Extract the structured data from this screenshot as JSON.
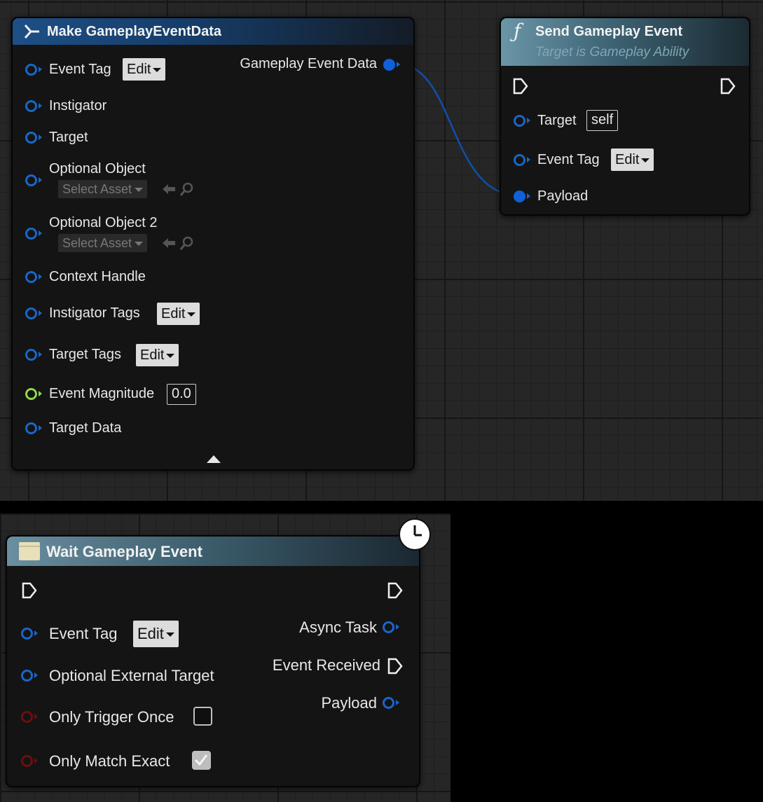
{
  "make_node": {
    "title": "Make GameplayEventData",
    "output_label": "Gameplay Event Data",
    "edit_label": "Edit",
    "select_asset_label": "Select Asset",
    "inputs": {
      "event_tag": "Event Tag",
      "instigator": "Instigator",
      "target": "Target",
      "optional_object": "Optional Object",
      "optional_object_2": "Optional Object 2",
      "context_handle": "Context Handle",
      "instigator_tags": "Instigator Tags",
      "target_tags": "Target Tags",
      "event_magnitude": "Event Magnitude",
      "target_data": "Target Data"
    },
    "event_magnitude_value": "0.0"
  },
  "send_node": {
    "title": "Send Gameplay Event",
    "subtitle": "Target is Gameplay Ability",
    "icon": "function-icon",
    "target_label": "Target",
    "target_value": "self",
    "event_tag_label": "Event Tag",
    "edit_label": "Edit",
    "payload_label": "Payload"
  },
  "wait_node": {
    "title": "Wait Gameplay Event",
    "edit_label": "Edit",
    "inputs": {
      "event_tag": "Event Tag",
      "optional_external_target": "Optional External Target",
      "only_trigger_once": "Only Trigger Once",
      "only_match_exact": "Only Match Exact"
    },
    "outputs": {
      "async_task": "Async Task",
      "event_received": "Event Received",
      "payload": "Payload"
    },
    "only_trigger_once_checked": false,
    "only_match_exact_checked": true
  },
  "colors": {
    "struct_pin": "#1a66c8",
    "float_pin": "#8cd94a",
    "bool_pin": "#6b0f0f",
    "wire": "#0f4fa8"
  }
}
